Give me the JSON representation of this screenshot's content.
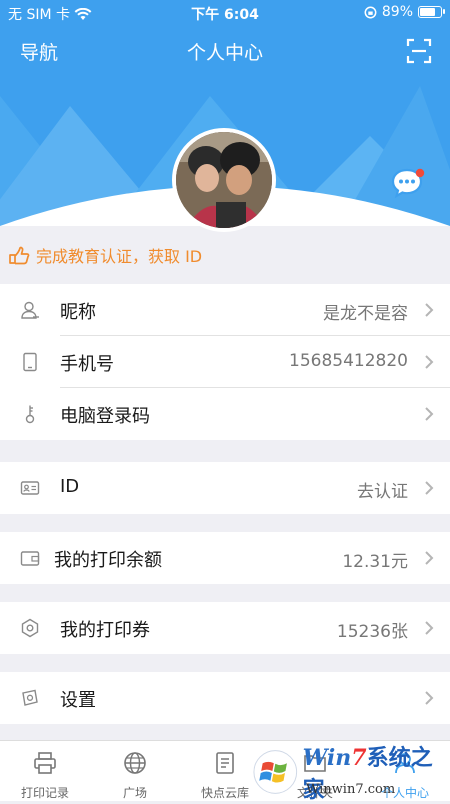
{
  "status_bar": {
    "carrier": "无 SIM 卡",
    "time": "下午 6:04",
    "battery_percent": "89%",
    "battery_level": 0.89
  },
  "navbar": {
    "left": "导航",
    "title": "个人中心"
  },
  "education_notice": "完成教育认证，获取 ID",
  "profile_rows": [
    {
      "label": "昵称",
      "value": "是龙不是容"
    },
    {
      "label": "手机号",
      "value": "15685412820"
    },
    {
      "label": "电脑登录码",
      "value": ""
    }
  ],
  "id_row": {
    "label": "ID",
    "value": "去认证"
  },
  "balance_row": {
    "label": "我的打印余额",
    "value": "12.31元"
  },
  "coupon_row": {
    "label": "我的打印券",
    "value": "15236张"
  },
  "settings_row": {
    "label": "设置"
  },
  "tabbar": {
    "tabs": [
      {
        "label": "打印记录",
        "icon": "printer-icon"
      },
      {
        "label": "广场",
        "icon": "globe-icon"
      },
      {
        "label": "快点云库",
        "icon": "document-icon"
      },
      {
        "label": "文件夹",
        "icon": "folder-icon"
      },
      {
        "label": "个人中心",
        "icon": "person-icon"
      }
    ],
    "active_index": 4
  },
  "watermark": {
    "brand_win": "Win",
    "brand_seven": "7",
    "brand_zh": "系统之家",
    "url": "Winwin7.com"
  },
  "colors": {
    "primary": "#3ea0ee",
    "notice": "#f08c2e",
    "badge": "#f04a3a"
  }
}
